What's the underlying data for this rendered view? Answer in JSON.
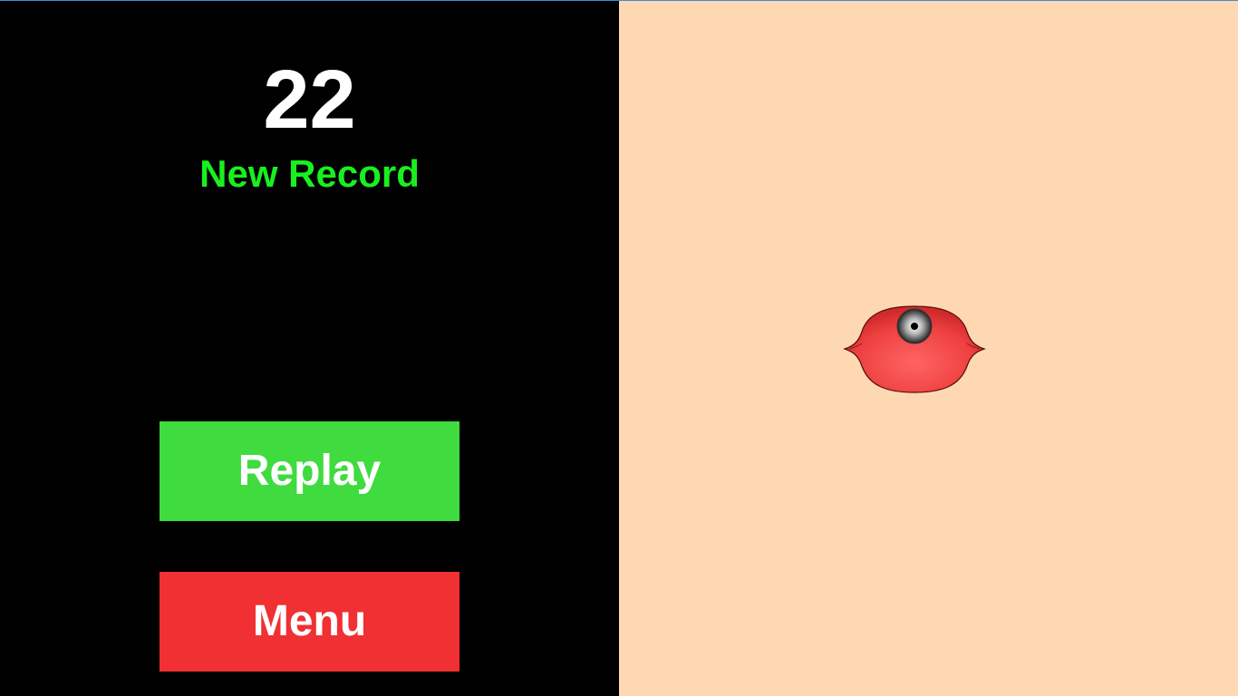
{
  "game": {
    "score": "22",
    "status": "New Record"
  },
  "buttons": {
    "replay_label": "Replay",
    "menu_label": "Menu"
  },
  "colors": {
    "left_panel_bg": "#000000",
    "right_panel_bg": "#fed8b2",
    "score_text": "#ffffff",
    "record_text": "#19f01e",
    "replay_button": "#3fdb3f",
    "menu_button": "#f03033",
    "creature_body": "#f04848"
  },
  "icons": {
    "creature": "red-one-eyed-blob-icon"
  }
}
